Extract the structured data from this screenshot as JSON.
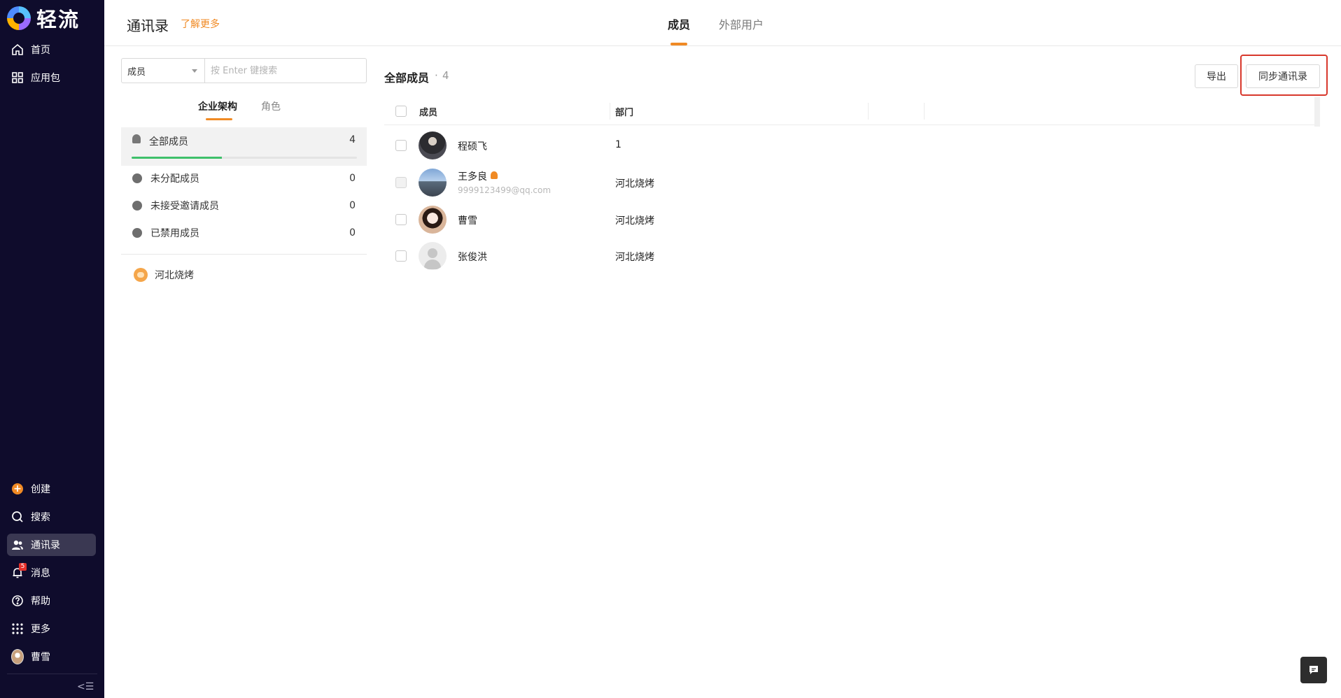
{
  "app": {
    "logo_text": "轻流"
  },
  "sidebar": {
    "top_items": [
      {
        "label": "首页",
        "icon": "home-icon"
      },
      {
        "label": "应用包",
        "icon": "apps-grid-icon"
      }
    ],
    "bottom_items": [
      {
        "label": "创建",
        "icon": "plus-circle-icon"
      },
      {
        "label": "搜索",
        "icon": "search-icon"
      },
      {
        "label": "通讯录",
        "icon": "contacts-icon",
        "active": true
      },
      {
        "label": "消息",
        "icon": "bell-icon",
        "badge": "5"
      },
      {
        "label": "帮助",
        "icon": "help-icon"
      },
      {
        "label": "更多",
        "icon": "more-grid-icon"
      },
      {
        "label": "曹雪",
        "icon": "user-avatar"
      }
    ],
    "collapse_glyph": "<☰"
  },
  "header": {
    "title": "通讯录",
    "learn_more": "了解更多",
    "tabs": [
      {
        "label": "成员",
        "active": true
      },
      {
        "label": "外部用户",
        "active": false
      }
    ]
  },
  "left_panel": {
    "search": {
      "scope": "成员",
      "placeholder": "按 Enter 键搜索"
    },
    "subtabs": [
      {
        "label": "企业架构",
        "active": true
      },
      {
        "label": "角色",
        "active": false
      }
    ],
    "groups": [
      {
        "label": "全部成员",
        "count": "4",
        "progress": 0.4
      },
      {
        "label": "未分配成员",
        "count": "0"
      },
      {
        "label": "未接受邀请成员",
        "count": "0"
      },
      {
        "label": "已禁用成员",
        "count": "0"
      }
    ],
    "departments": [
      {
        "label": "河北烧烤"
      }
    ]
  },
  "main": {
    "list_title": "全部成员",
    "list_separator": "·",
    "list_count": "4",
    "export_label": "导出",
    "sync_label": "同步通讯录",
    "columns": {
      "member": "成员",
      "dept": "部门"
    },
    "rows": [
      {
        "name": "程硕飞",
        "email": "",
        "dept": "1",
        "admin": false
      },
      {
        "name": "王多良",
        "email": "9999123499@qq.com",
        "dept": "河北烧烤",
        "admin": true
      },
      {
        "name": "曹雪",
        "email": "",
        "dept": "河北烧烤",
        "admin": false
      },
      {
        "name": "张俊洪",
        "email": "",
        "dept": "河北烧烤",
        "admin": false
      }
    ]
  },
  "colors": {
    "accent": "#f08a24",
    "sidebar_bg": "#0f0c2c",
    "progress": "#3ec06b",
    "highlight": "#d8382c"
  }
}
